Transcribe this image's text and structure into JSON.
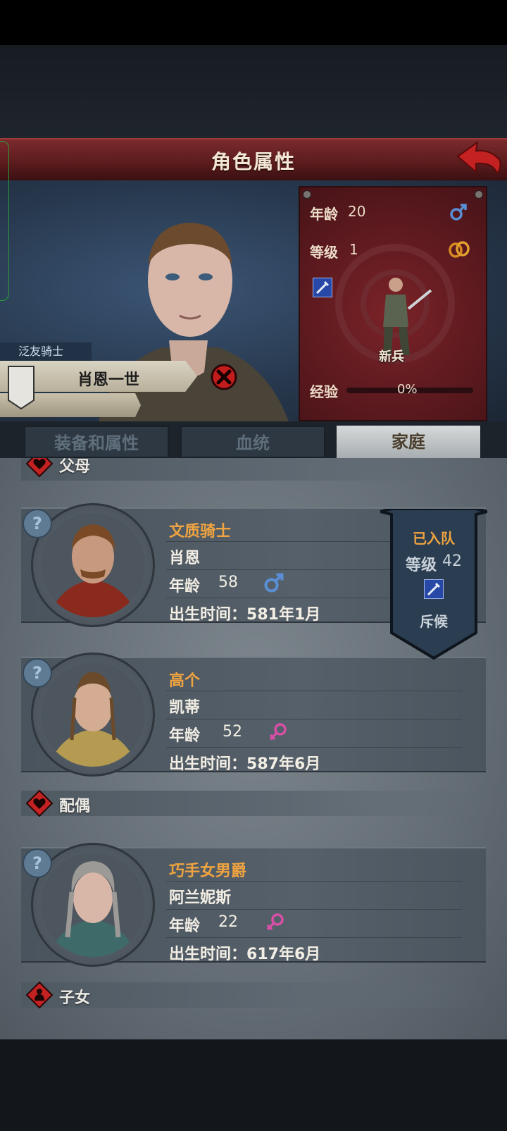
{
  "header": {
    "title": "角色属性"
  },
  "character": {
    "title": "泛友骑士",
    "name": "肖恩一世",
    "stats": {
      "age_label": "年龄",
      "age": "20",
      "level_label": "等级",
      "level": "1",
      "unit_label": "新兵",
      "exp_label": "经验",
      "exp_value": "0%",
      "exp_progress": 0
    }
  },
  "tabs": [
    {
      "label": "装备和属性",
      "active": false
    },
    {
      "label": "血统",
      "active": false
    },
    {
      "label": "家庭",
      "active": true
    }
  ],
  "sections": {
    "parents": "父母",
    "spouse": "配偶",
    "children": "子女"
  },
  "members": [
    {
      "title": "文质骑士",
      "name": "肖恩",
      "age_label": "年龄",
      "age": "58",
      "gender": "male",
      "birth_label": "出生时间：",
      "birth": "581年1月"
    },
    {
      "title": "高个",
      "name": "凯蒂",
      "age_label": "年龄",
      "age": "52",
      "gender": "female",
      "birth_label": "出生时间：",
      "birth": "587年6月"
    },
    {
      "title": "巧手女男爵",
      "name": "阿兰妮斯",
      "age_label": "年龄",
      "age": "22",
      "gender": "female",
      "birth_label": "出生时间：",
      "birth": "617年6月"
    }
  ],
  "party_flag": {
    "status": "已入队",
    "level_label": "等级",
    "level": "42",
    "class_label": "斥候"
  },
  "colors": {
    "accent_orange": "#f0a440",
    "male_blue": "#5a8fd6",
    "female_pink": "#d84fa6",
    "title_red": "#5a1b1d"
  },
  "icons": [
    "back-arrow-icon",
    "male-icon",
    "female-icon",
    "ring-icon",
    "dagger-icon",
    "heart-icon",
    "close-icon",
    "question-icon"
  ]
}
